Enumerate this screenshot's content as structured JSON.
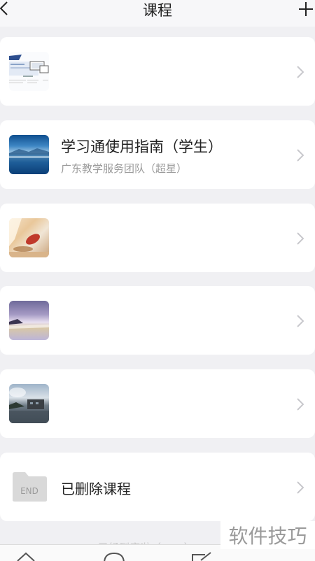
{
  "header": {
    "title": "课程",
    "back_icon": "chevron-left-icon",
    "add_icon": "plus-icon"
  },
  "courses": [
    {
      "title": "",
      "subtitle": "",
      "thumb": "slide-document-thumbnail"
    },
    {
      "title": "学习通使用指南（学生）",
      "subtitle": "广东教学服务团队（超星）",
      "thumb": "lake-landscape-thumbnail"
    },
    {
      "title": "",
      "subtitle": "",
      "thumb": "autumn-leaf-thumbnail"
    },
    {
      "title": "",
      "subtitle": "",
      "thumb": "purple-sunset-thumbnail"
    },
    {
      "title": "",
      "subtitle": "",
      "thumb": "lakeside-building-thumbnail"
    }
  ],
  "deleted_courses": {
    "label": "已删除课程",
    "folder_label": "END"
  },
  "watermark": "软件技巧",
  "footer_hint": "已经到底啦（~_~）",
  "colors": {
    "background": "#f0f0f3",
    "card": "#ffffff",
    "secondary_text": "#9a9a9a",
    "chevron": "#c8c8cc"
  }
}
